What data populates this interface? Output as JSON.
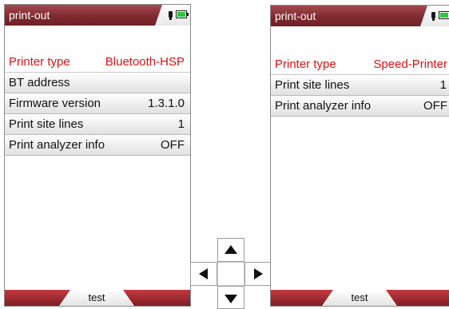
{
  "left_screen": {
    "title": "print-out",
    "status_icons": [
      "plug-icon",
      "battery-icon"
    ],
    "menu": [
      {
        "label": "Printer type",
        "value": "Bluetooth-HSP",
        "highlighted": true
      },
      {
        "label": "BT address",
        "value": ""
      },
      {
        "label": "Firmware version",
        "value": "1.3.1.0"
      },
      {
        "label": "Print site lines",
        "value": "1"
      },
      {
        "label": "Print analyzer info",
        "value": "OFF"
      }
    ],
    "softkey": "test"
  },
  "right_screen": {
    "title": "print-out",
    "status_icons": [
      "plug-icon",
      "battery-icon"
    ],
    "menu": [
      {
        "label": "Printer type",
        "value": "Speed-Printer",
        "highlighted": true
      },
      {
        "label": "Print site lines",
        "value": "1"
      },
      {
        "label": "Print analyzer info",
        "value": "OFF"
      }
    ],
    "softkey": "test"
  },
  "navigation_pad": {
    "icons": [
      "arrow-up-icon",
      "arrow-left-icon",
      "arrow-right-icon",
      "arrow-down-icon"
    ]
  },
  "colors": {
    "titlebar": "#7f2a30",
    "highlight_text": "#e01010",
    "battery_fill": "#2bc33b",
    "bottombar": "#9a2a30"
  }
}
